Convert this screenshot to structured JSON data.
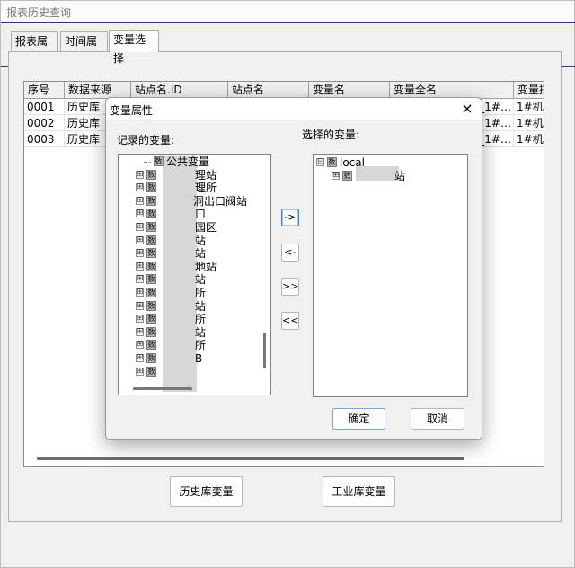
{
  "window": {
    "title": "报表历史查询"
  },
  "tabs": [
    {
      "label": "报表属性"
    },
    {
      "label": "时间属性"
    },
    {
      "label": "变量选择"
    }
  ],
  "grid": {
    "columns": [
      "序号",
      "数据来源",
      "站点名.ID",
      "站点名",
      "变量名",
      "变量全名",
      "变量描"
    ],
    "rows": [
      [
        "0001",
        "历史库",
        "",
        "",
        "",
        "_1#…",
        "1#机…"
      ],
      [
        "0002",
        "历史库",
        "",
        "",
        "",
        "_1#…",
        "1#机…"
      ],
      [
        "0003",
        "历史库",
        "",
        "",
        "",
        "_1#…",
        "1#机…"
      ]
    ]
  },
  "buttons": {
    "historian_vars": "历史库变量",
    "industrial_vars": "工业库变量"
  },
  "dialog": {
    "title": "变量属性",
    "close_icon": "×",
    "recorded_label": "记录的变量:",
    "selected_label": "选择的变量:",
    "left_tree": [
      {
        "expander": "",
        "text": "公共变量"
      },
      {
        "expander": "⊞",
        "text": "理站"
      },
      {
        "expander": "⊞",
        "text": "理所"
      },
      {
        "expander": "⊞",
        "text": "洞出口阀站"
      },
      {
        "expander": "⊞",
        "text": "口"
      },
      {
        "expander": "⊞",
        "text": "园区"
      },
      {
        "expander": "⊞",
        "text": "站"
      },
      {
        "expander": "⊞",
        "text": "站"
      },
      {
        "expander": "⊞",
        "text": "地站"
      },
      {
        "expander": "⊞",
        "text": "站"
      },
      {
        "expander": "⊞",
        "text": "所"
      },
      {
        "expander": "⊞",
        "text": "站"
      },
      {
        "expander": "⊞",
        "text": "所"
      },
      {
        "expander": "⊞",
        "text": "站"
      },
      {
        "expander": "⊞",
        "text": "所"
      },
      {
        "expander": "⊞",
        "text": "B"
      },
      {
        "expander": "⊞",
        "text": ""
      }
    ],
    "right_tree": [
      {
        "expander": "⊟",
        "text": "local"
      },
      {
        "expander": "⊞",
        "text": "站"
      }
    ],
    "move_buttons": {
      "add": "->",
      "remove": "<-",
      "add_all": ">>",
      "remove_all": "<<"
    },
    "ok": "确定",
    "cancel": "取消"
  },
  "colors": {
    "focus": "#3c7fd6",
    "strip": "#2c3f66"
  }
}
